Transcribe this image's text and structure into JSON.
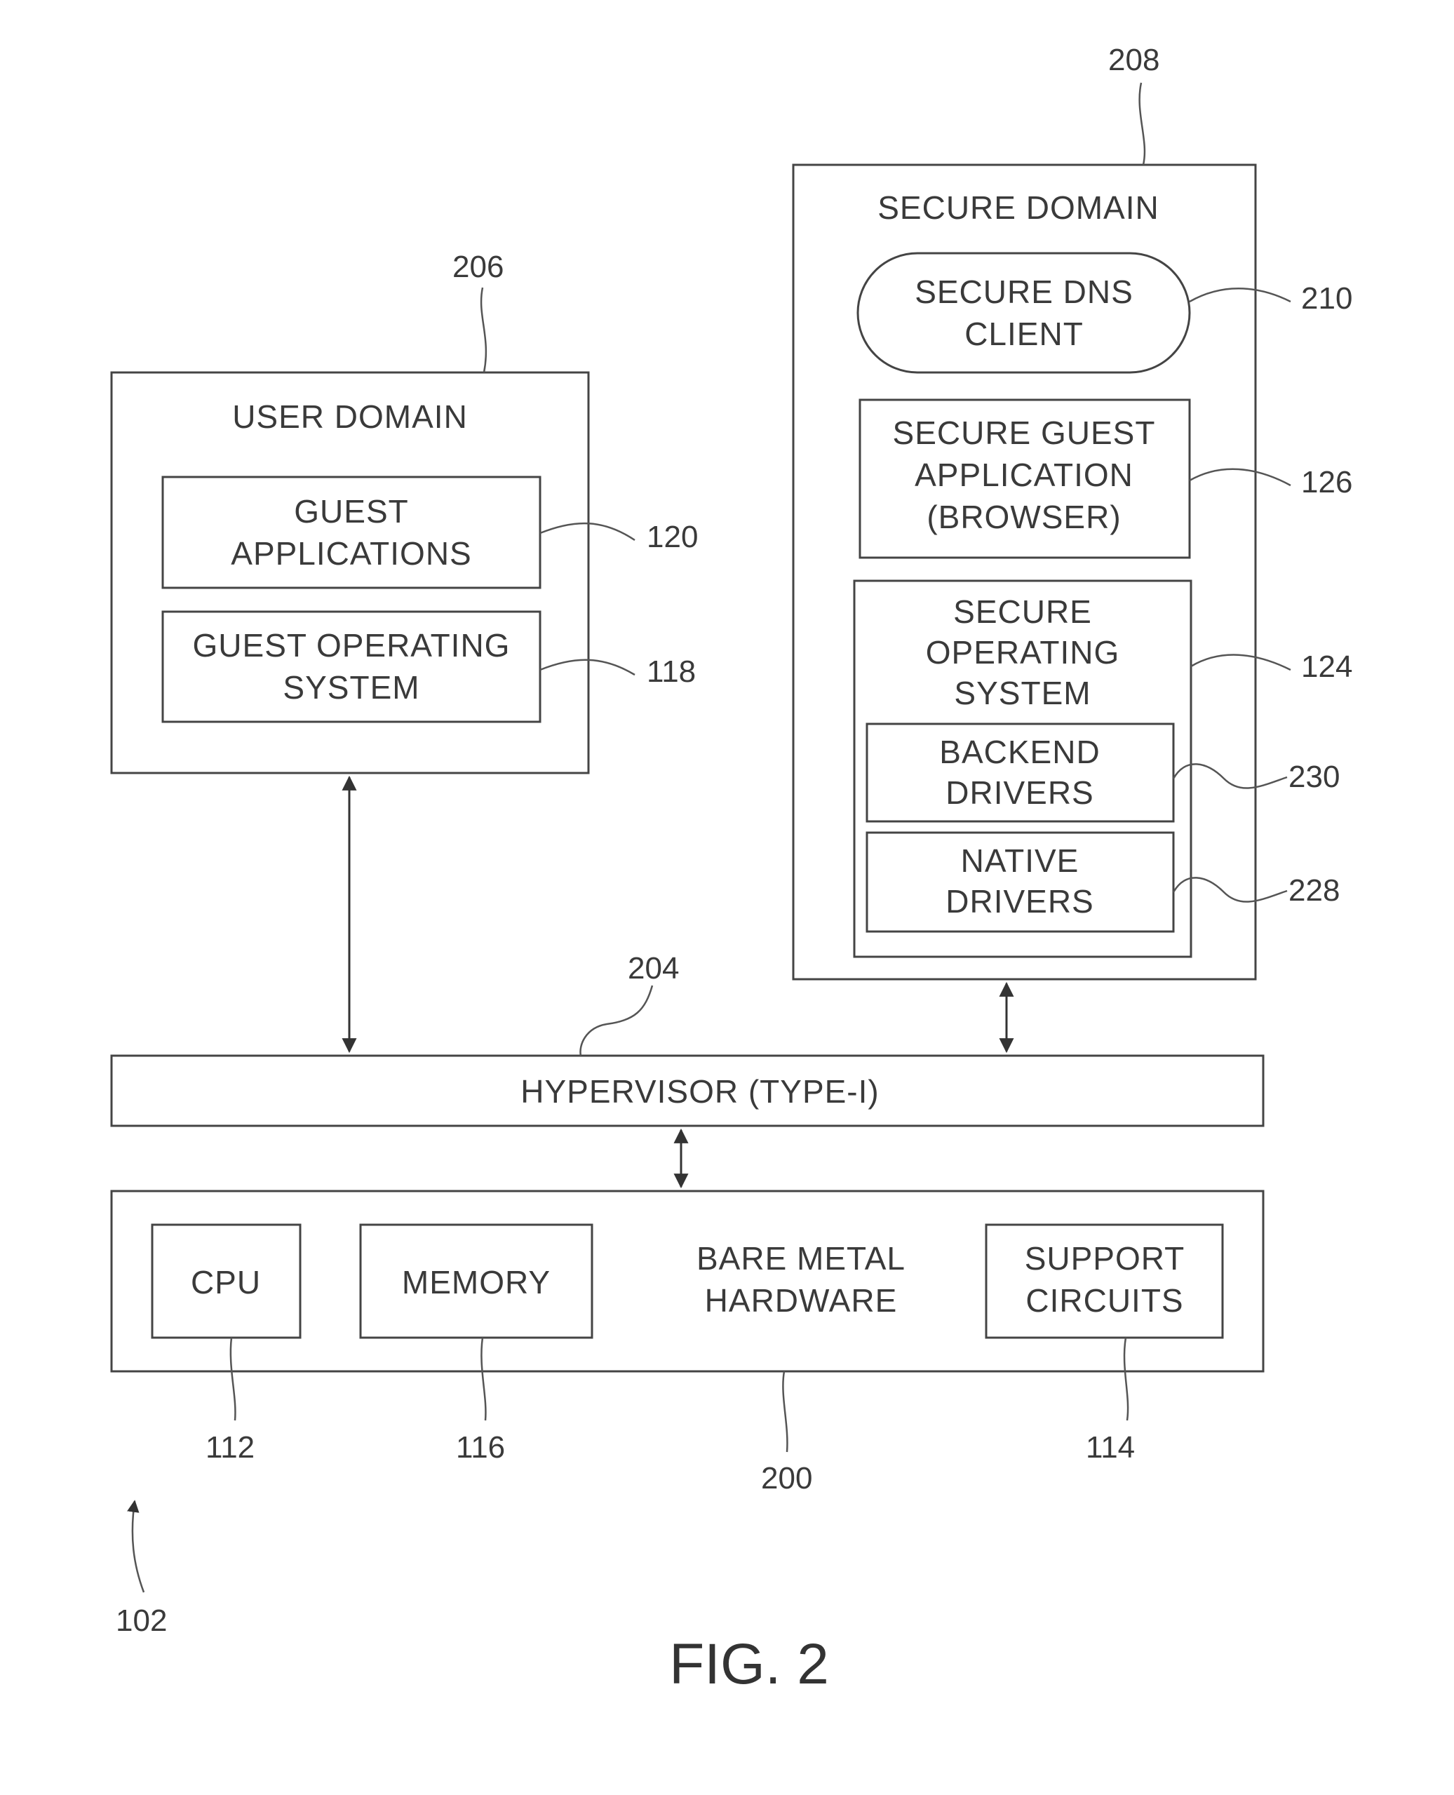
{
  "figure": {
    "caption": "FIG. 2",
    "system_ref": "102"
  },
  "user_domain": {
    "title": "USER DOMAIN",
    "ref": "206",
    "guest_applications": {
      "lines": [
        "GUEST",
        "APPLICATIONS"
      ],
      "ref": "120"
    },
    "guest_os": {
      "lines": [
        "GUEST OPERATING",
        "SYSTEM"
      ],
      "ref": "118"
    }
  },
  "secure_domain": {
    "title": "SECURE DOMAIN",
    "ref": "208",
    "dns_client": {
      "lines": [
        "SECURE DNS",
        "CLIENT"
      ],
      "ref": "210"
    },
    "secure_guest_app": {
      "lines": [
        "SECURE GUEST",
        "APPLICATION",
        "(BROWSER)"
      ],
      "ref": "126"
    },
    "secure_os": {
      "lines": [
        "SECURE",
        "OPERATING",
        "SYSTEM"
      ],
      "ref": "124",
      "backend_drivers": {
        "lines": [
          "BACKEND",
          "DRIVERS"
        ],
        "ref": "230"
      },
      "native_drivers": {
        "lines": [
          "NATIVE",
          "DRIVERS"
        ],
        "ref": "228"
      }
    }
  },
  "hypervisor": {
    "label": "HYPERVISOR (TYPE-I)",
    "ref": "204"
  },
  "hardware": {
    "lines": [
      "BARE METAL",
      "HARDWARE"
    ],
    "ref": "200",
    "cpu": {
      "label": "CPU",
      "ref": "112"
    },
    "memory": {
      "label": "MEMORY",
      "ref": "116"
    },
    "support_circuits": {
      "lines": [
        "SUPPORT",
        "CIRCUITS"
      ],
      "ref": "114"
    }
  }
}
